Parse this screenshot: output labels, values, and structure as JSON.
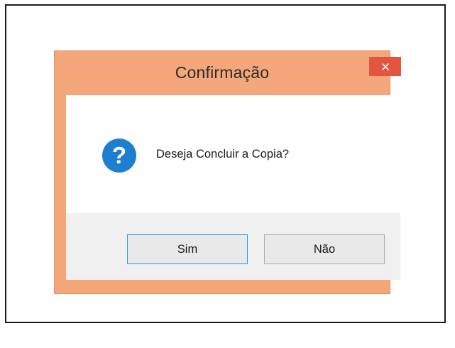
{
  "dialog": {
    "title": "Confirmação",
    "close_symbol": "×",
    "message": "Deseja Concluir a Copia?",
    "icon": "question-icon",
    "buttons": {
      "yes_label": "Sim",
      "no_label": "Não"
    },
    "colors": {
      "frame": "#f4a77a",
      "close_button": "#e2553f",
      "icon": "#1e7fd1",
      "default_button_border": "#3a99dc"
    }
  }
}
